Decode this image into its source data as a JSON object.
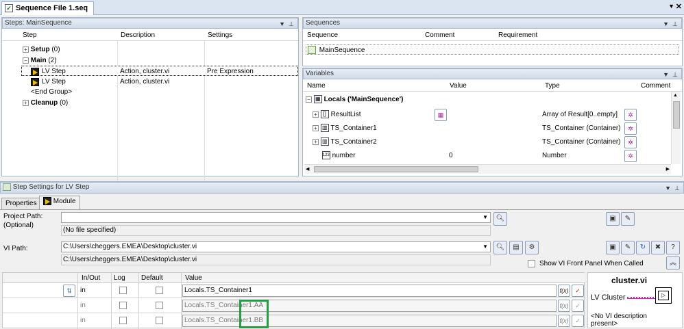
{
  "window": {
    "title": "Sequence File 1.seq"
  },
  "steps": {
    "header": "Steps: MainSequence",
    "columns": [
      "Step",
      "Description",
      "Settings"
    ],
    "rows": [
      {
        "name": "Setup",
        "count": "(0)",
        "desc": "",
        "settings": ""
      },
      {
        "name": "Main",
        "count": "(2)",
        "desc": "",
        "settings": ""
      },
      {
        "name": "LV Step",
        "count": "",
        "desc": "Action,  cluster.vi",
        "settings": "Pre Expression"
      },
      {
        "name": "LV Step",
        "count": "",
        "desc": "Action,  cluster.vi",
        "settings": ""
      },
      {
        "name": "<End Group>",
        "count": "",
        "desc": "",
        "settings": ""
      },
      {
        "name": "Cleanup",
        "count": "(0)",
        "desc": "",
        "settings": ""
      }
    ]
  },
  "sequences": {
    "header": "Sequences",
    "columns": [
      "Sequence",
      "Comment",
      "Requirement"
    ],
    "items": [
      "MainSequence"
    ]
  },
  "variables": {
    "header": "Variables",
    "columns": [
      "Name",
      "Value",
      "Type",
      "Comment"
    ],
    "root": "Locals ('MainSequence')",
    "rows": [
      {
        "name": "ResultList",
        "value": "",
        "type": "Array of Result[0..empty]"
      },
      {
        "name": "TS_Container1",
        "value": "",
        "type": "TS_Container (Container)"
      },
      {
        "name": "TS_Container2",
        "value": "",
        "type": "TS_Container (Container)"
      },
      {
        "name": "number",
        "value": "0",
        "type": "Number"
      }
    ]
  },
  "settings": {
    "header": "Step Settings for LV Step",
    "tabs": [
      "Properties",
      "Module"
    ],
    "project_path_label": "Project Path:",
    "optional_label": "(Optional)",
    "project_path_value": "",
    "no_file": "(No file specified)",
    "vi_path_label": "VI Path:",
    "vi_path_value": "C:\\Users\\cheggers.EMEA\\Desktop\\cluster.vi",
    "vi_path_resolved": "C:\\Users\\cheggers.EMEA\\Desktop\\cluster.vi",
    "show_front_panel": "Show VI Front Panel When Called",
    "param_columns": [
      "In/Out",
      "Log",
      "Default",
      "Value"
    ],
    "params": [
      {
        "inout": "in",
        "value": "Locals.TS_Container1"
      },
      {
        "inout": "in",
        "value": "Locals.TS_Container1.AA"
      },
      {
        "inout": "in",
        "value": "Locals.TS_Container1.BB"
      }
    ],
    "vi_name": "cluster.vi",
    "lv_cluster_label": "LV Cluster",
    "no_desc": "<No VI description present>"
  }
}
